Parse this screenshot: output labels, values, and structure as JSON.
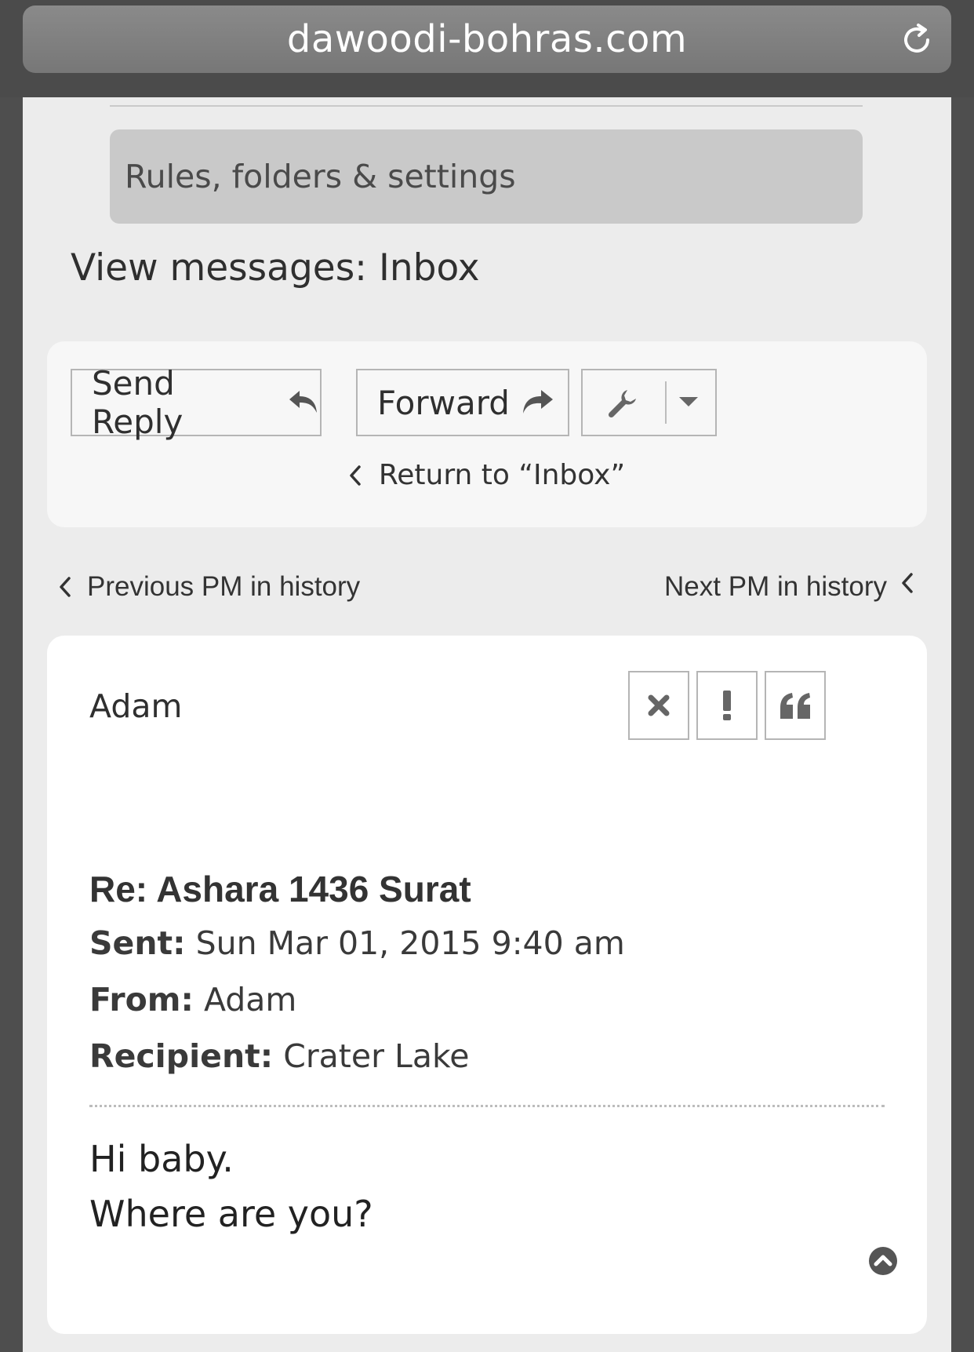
{
  "browser": {
    "url": "dawoodi-bohras.com",
    "reload_icon": "reload-icon"
  },
  "nav": {
    "settings_label": "Rules, folders & settings"
  },
  "view": {
    "title": "View messages: Inbox"
  },
  "actions": {
    "reply_label": "Send Reply",
    "reply_icon": "reply-icon",
    "forward_label": "Forward",
    "forward_icon": "forward-icon",
    "tools_icon": "wrench-icon",
    "tools_dropdown_icon": "caret-down-icon",
    "return_label": "Return to “Inbox”"
  },
  "history": {
    "prev_label": "Previous PM in history",
    "next_label": "Next PM in history"
  },
  "message": {
    "author": "Adam",
    "subject": "Re: Ashara 1436 Surat",
    "sent_label": "Sent:",
    "sent_value": "Sun Mar 01, 2015 9:40 am",
    "from_label": "From:",
    "from_value": "Adam",
    "recipient_label": "Recipient:",
    "recipient_value": "Crater Lake",
    "body_lines": [
      "Hi baby.",
      "Where are you?"
    ],
    "icons": [
      "close-icon",
      "exclamation-icon",
      "quote-icon",
      "chevron-up-circle-icon"
    ]
  },
  "colors": {
    "page_bg": "#ececec",
    "panel_bg": "#f7f7f7",
    "card_bg": "#ffffff",
    "toolbar_bg": "#4b4b4b"
  }
}
